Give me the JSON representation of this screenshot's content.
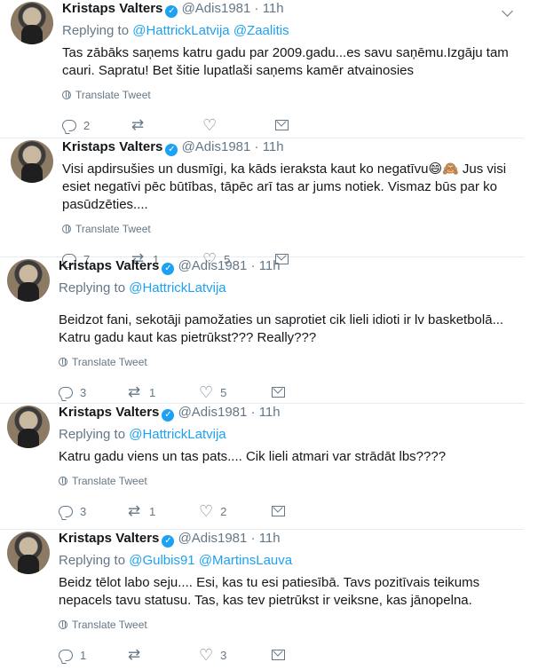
{
  "tweets": [
    {
      "name": "Kristaps Valters",
      "handle": "@Adis1981",
      "dot": "·",
      "time": "11h",
      "reply_label": "Replying to",
      "mentions": [
        "@HattrickLatvija",
        "@Zaalitis"
      ],
      "text": "Tas zābāks saņems katru gadu par 2009.gadu...es savu saņēmu.Izgāju tam cauri. Sapratu! Bet šitie lupatlaši saņems kamēr atvainosies",
      "translate_label": "Translate Tweet",
      "replies": "2",
      "retweets": "",
      "likes": ""
    },
    {
      "name": "Kristaps Valters",
      "handle": "@Adis1981",
      "dot": "·",
      "time": "11h",
      "reply_label": "",
      "mentions": [],
      "text": "Visi apdirsušies un dusmīgi, ka kāds ieraksta kaut ko negatīvu😄🙈 Jus visi esiet negatīvi pēc būtības, tāpēc arī tas ar jums notiek. Vismaz būs par ko pasūdzēties....",
      "translate_label": "Translate Tweet",
      "replies": "7",
      "retweets": "1",
      "likes": "5"
    },
    {
      "name": "Kristaps Valters",
      "handle": "@Adis1981",
      "dot": "·",
      "time": "11h",
      "reply_label": "Replying to",
      "mentions": [
        "@HattrickLatvija"
      ],
      "text": "Beidzot fani, sekotāji pamožaties un saprotiet cik lieli idioti ir lv basketbolā... Katru gadu kaut kas pietrūkst??? Really???",
      "translate_label": "Translate Tweet",
      "replies": "3",
      "retweets": "1",
      "likes": "5"
    },
    {
      "name": "Kristaps Valters",
      "handle": "@Adis1981",
      "dot": "·",
      "time": "11h",
      "reply_label": "Replying to",
      "mentions": [
        "@HattrickLatvija"
      ],
      "text": "Katru gadu viens un tas pats.... Cik lieli atmari var strādāt lbs????",
      "translate_label": "Translate Tweet",
      "replies": "3",
      "retweets": "1",
      "likes": "2"
    },
    {
      "name": "Kristaps Valters",
      "handle": "@Adis1981",
      "dot": "·",
      "time": "11h",
      "reply_label": "Replying to",
      "mentions": [
        "@Gulbis91",
        "@MartinsLauva"
      ],
      "text": "Beidz tēlot labo seju.... Esi, kas tu esi patiesībā. Tavs pozitīvais teikums nepacels tavu statusu. Tas, kas tev pietrūkst ir veiksne, kas jānopelna.",
      "translate_label": "Translate Tweet",
      "replies": "1",
      "retweets": "",
      "likes": "3"
    }
  ],
  "icons": {
    "reply": "reply-icon",
    "retweet": "retweet-icon",
    "like": "heart-icon",
    "dm": "envelope-icon",
    "verified": "verified-badge-icon",
    "translate": "globe-icon",
    "caret": "chevron-down-icon"
  },
  "colors": {
    "link": "#1da1f2",
    "muted": "#657786",
    "text": "#14171a",
    "border": "#e6ecf0"
  }
}
